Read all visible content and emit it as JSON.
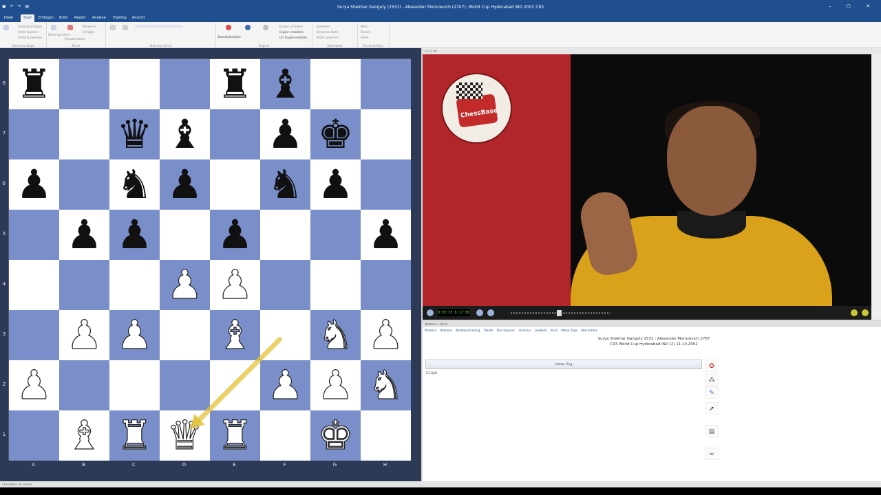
{
  "window": {
    "title": "Surya Shekhar Ganguly (2531) - Alexander Morozevich (2707), World Cup Hyderabad IND 2002  C93"
  },
  "tabs": [
    "Datei",
    "Start",
    "Einfügen",
    "Brett",
    "Report",
    "Analyse",
    "Training",
    "Ansicht"
  ],
  "active_tab": "Start",
  "ribbon": {
    "groups": [
      "Zwischenablage",
      "Partie",
      "Stellung suchen",
      "Engines",
      "Datenbank",
      "Partieneinfluss"
    ],
    "items": {
      "clipboard": [
        "Stellung einfügen",
        "Partie kopieren",
        "Stellung kopieren"
      ],
      "game": [
        "Partie speichern",
        "Eingabemodus",
        "Einfügen",
        "Markieren"
      ],
      "engines": [
        "Standardanalyse",
        "Kiebitz-Schachrechner",
        "Andere Engine",
        "Engine schließen",
        "Engine verwalten",
        "UCI Engine erstellen"
      ],
      "database": [
        "Einstellen",
        "Varianten Partie",
        "Partie speichern"
      ],
      "influence": [
        "Notiz",
        "Bericht",
        "Partie"
      ]
    }
  },
  "video": {
    "header": "v1.c2 mt",
    "time": "0:07:55 0:17:30",
    "logo_text": "ChessBase"
  },
  "notation": {
    "header": "Notation + Buch",
    "tabs": [
      "Notation",
      "Referenz",
      "Nachspieltraining",
      "Tabelle",
      "Plan Explorer",
      "Formular",
      "LiveBuch",
      "Buch",
      "Meine Züge",
      "Übersichten"
    ],
    "white": "Surya Shekhar Ganguly 2531",
    "black": "Alexander Morozevich 2707",
    "event": "C93 World Cup Hyderabad IND (2) 11.10.2002",
    "last_move_label": "letzter Zug",
    "moves": "21.Qd1"
  },
  "tools": [
    "wheel-icon",
    "balls-icon",
    "eyedropper-icon",
    "cursor-icon",
    "save-icon",
    "glasses-icon"
  ],
  "status": {
    "left": "ChessBase 16 cinema"
  },
  "board": {
    "files": [
      "A",
      "B",
      "C",
      "D",
      "E",
      "F",
      "G",
      "H"
    ],
    "ranks": [
      "8",
      "7",
      "6",
      "5",
      "4",
      "3",
      "2",
      "1"
    ],
    "position": [
      [
        "br",
        "",
        "",
        "",
        "br",
        "bb",
        "",
        ""
      ],
      [
        "",
        "",
        "bq",
        "bb",
        "",
        "bp",
        "bk",
        ""
      ],
      [
        "bp",
        "",
        "bn",
        "bp",
        "",
        "bn",
        "bp",
        ""
      ],
      [
        "",
        "bp",
        "bp",
        "",
        "bp",
        "",
        "",
        "bp"
      ],
      [
        "",
        "",
        "",
        "wp",
        "wp",
        "",
        "",
        ""
      ],
      [
        "",
        "wp",
        "wp",
        "",
        "wb",
        "",
        "wn",
        "wp"
      ],
      [
        "wp",
        "",
        "",
        "",
        "",
        "wp",
        "wp",
        "wn"
      ],
      [
        "",
        "wb",
        "wr",
        "wq",
        "wr",
        "",
        "wk",
        ""
      ]
    ],
    "arrow": {
      "from": "f3",
      "to": "d1",
      "color": "#e2c23a"
    }
  }
}
